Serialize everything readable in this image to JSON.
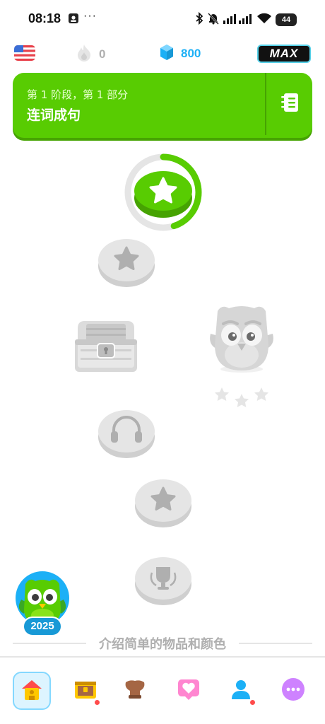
{
  "status_bar": {
    "time": "08:18",
    "more": "···",
    "battery": "44"
  },
  "top_bar": {
    "course_flag": "us-flag-icon",
    "streak": "0",
    "gems": "800",
    "subscription": "MAX"
  },
  "unit": {
    "subtitle": "第 1 阶段，第 1 部分",
    "title": "连词成句",
    "guide_icon": "notebook-icon"
  },
  "path_nodes": [
    {
      "type": "star",
      "state": "current",
      "progress": 0.45
    },
    {
      "type": "star",
      "state": "locked"
    },
    {
      "type": "chest",
      "state": "locked"
    },
    {
      "type": "character",
      "state": "locked"
    },
    {
      "type": "headphones",
      "state": "locked"
    },
    {
      "type": "star",
      "state": "locked"
    },
    {
      "type": "trophy",
      "state": "locked"
    }
  ],
  "event_badge": {
    "year": "2025"
  },
  "next_section": {
    "label": "介绍简单的物品和颜色"
  },
  "bottom_nav": [
    {
      "name": "home",
      "icon": "home-icon",
      "active": true,
      "dot": false
    },
    {
      "name": "chest",
      "icon": "treasure-chest-icon",
      "active": false,
      "dot": true
    },
    {
      "name": "leagues",
      "icon": "shield-icon",
      "active": false,
      "dot": false
    },
    {
      "name": "hearts",
      "icon": "heart-icon",
      "active": false,
      "dot": false
    },
    {
      "name": "profile",
      "icon": "profile-icon",
      "active": false,
      "dot": true
    },
    {
      "name": "more",
      "icon": "more-icon",
      "active": false,
      "dot": false
    }
  ],
  "colors": {
    "green": "#58cc02",
    "green_dark": "#46a302",
    "blue": "#1cb0f6",
    "locked": "#e5e5e5"
  }
}
